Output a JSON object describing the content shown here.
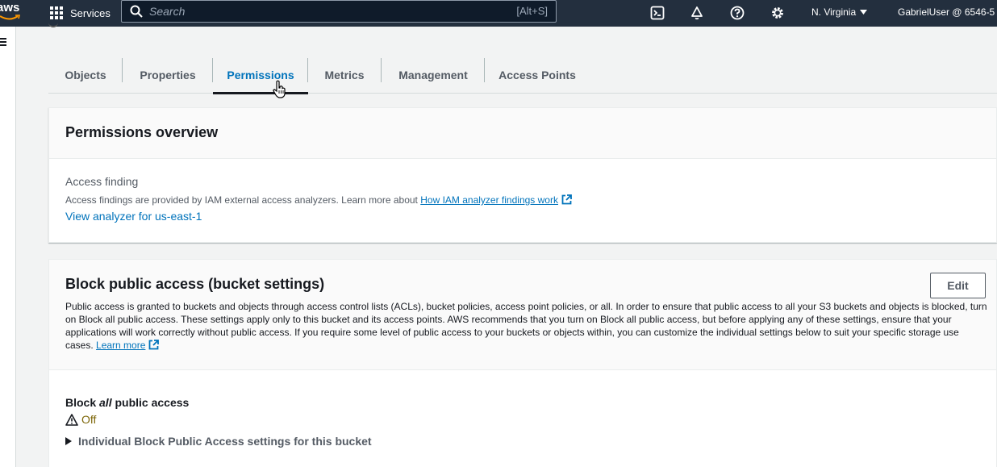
{
  "topnav": {
    "logo_text": "aws",
    "services_label": "Services",
    "search_placeholder": "Search",
    "search_shortcut": "[Alt+S]",
    "region_label": "N. Virginia",
    "user_label": "GabrielUser @ 6546-5",
    "icons": [
      "cloudshell-icon",
      "bell-icon",
      "help-icon",
      "gear-icon"
    ]
  },
  "tabs": [
    {
      "label": "Objects",
      "active": false
    },
    {
      "label": "Properties",
      "active": false
    },
    {
      "label": "Permissions",
      "active": true
    },
    {
      "label": "Metrics",
      "active": false
    },
    {
      "label": "Management",
      "active": false
    },
    {
      "label": "Access Points",
      "active": false
    }
  ],
  "permissions_overview": {
    "title": "Permissions overview",
    "access_finding_label": "Access finding",
    "access_finding_desc": "Access findings are provided by IAM external access analyzers. Learn more about",
    "access_finding_link": "How IAM analyzer findings work",
    "analyzer_link": "View analyzer for us-east-1"
  },
  "block_public_access": {
    "title": "Block public access (bucket settings)",
    "edit_label": "Edit",
    "description": "Public access is granted to buckets and objects through access control lists (ACLs), bucket policies, access point policies, or all. In order to ensure that public access to all your S3 buckets and objects is blocked, turn on Block all public access. These settings apply only to this bucket and its access points. AWS recommends that you turn on Block all public access, but before applying any of these settings, ensure that your applications will work correctly without public access. If you require some level of public access to your buckets or objects within, you can customize the individual settings below to suit your specific storage use cases.",
    "learn_more": "Learn more",
    "block_all_prefix": "Block ",
    "block_all_emph": "all",
    "block_all_suffix": " public access",
    "status": "Off",
    "status_color": "#7d6608",
    "expander_label": "Individual Block Public Access settings for this bucket"
  },
  "colors": {
    "nav_bg": "#232f3e",
    "link": "#0073bb",
    "active_tab": "#0073bb"
  }
}
